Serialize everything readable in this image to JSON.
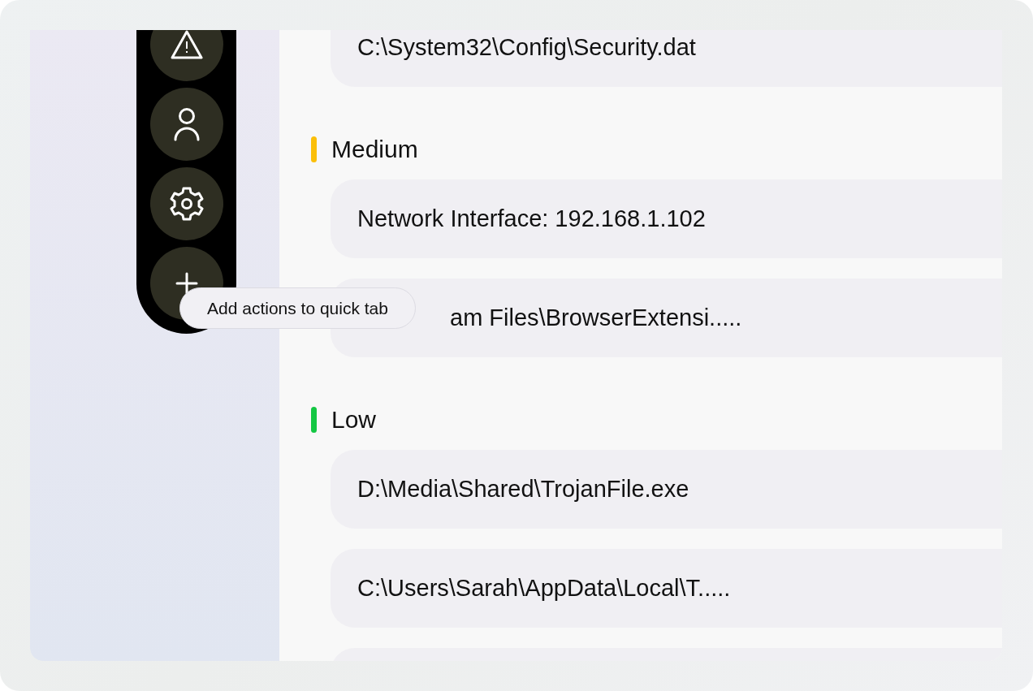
{
  "quick_tab": {
    "buttons": [
      {
        "kind": "warning"
      },
      {
        "kind": "user"
      },
      {
        "kind": "settings"
      },
      {
        "kind": "add"
      }
    ],
    "tooltip": "Add actions to quick tab"
  },
  "groups": [
    {
      "items": [
        {
          "kind": "entry",
          "text": "C:\\System32\\Config\\Security.dat"
        }
      ]
    },
    {
      "title": "Medium",
      "color": "#fbbf09",
      "items": [
        {
          "kind": "entry",
          "text": "Network Interface: 192.168.1.102"
        },
        {
          "kind": "entry",
          "text": "am Files\\BrowserExtensi....."
        }
      ]
    },
    {
      "title": "Low",
      "color": "#14c743",
      "items": [
        {
          "kind": "entry",
          "text": "D:\\Media\\Shared\\TrojanFile.exe"
        },
        {
          "kind": "entry",
          "text": "C:\\Users\\Sarah\\AppData\\Local\\T....."
        },
        {
          "kind": "entry"
        }
      ]
    }
  ]
}
